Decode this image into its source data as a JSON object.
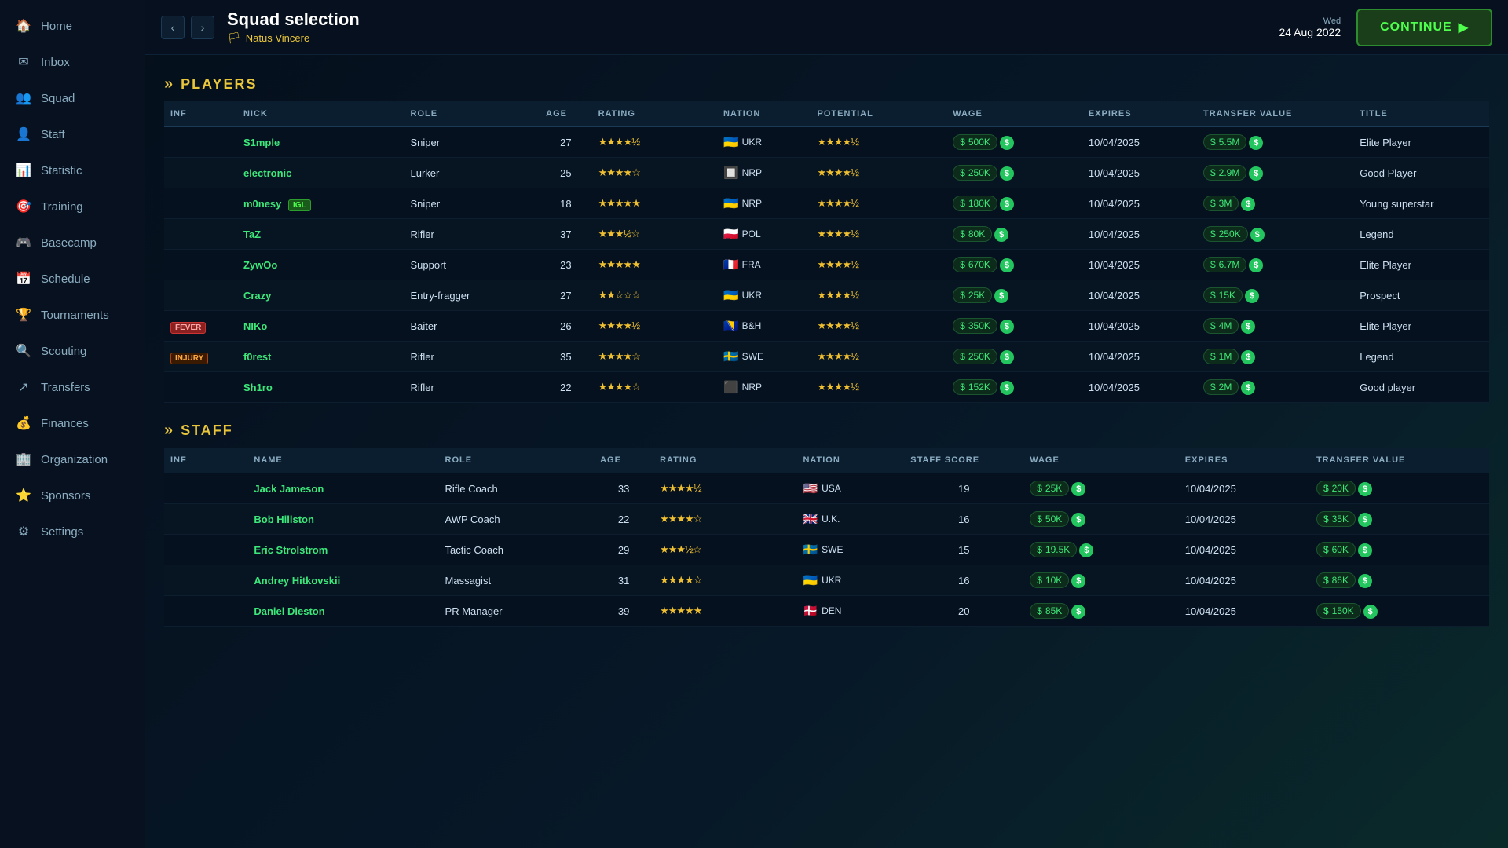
{
  "sidebar": {
    "items": [
      {
        "id": "home",
        "label": "Home",
        "icon": "🏠"
      },
      {
        "id": "inbox",
        "label": "Inbox",
        "icon": "✉"
      },
      {
        "id": "squad",
        "label": "Squad",
        "icon": "👥"
      },
      {
        "id": "staff",
        "label": "Staff",
        "icon": "👤"
      },
      {
        "id": "statistic",
        "label": "Statistic",
        "icon": "📊"
      },
      {
        "id": "training",
        "label": "Training",
        "icon": "🎯"
      },
      {
        "id": "basecamp",
        "label": "Basecamp",
        "icon": "🎮"
      },
      {
        "id": "schedule",
        "label": "Schedule",
        "icon": "📅"
      },
      {
        "id": "tournaments",
        "label": "Tournaments",
        "icon": "🏆"
      },
      {
        "id": "scouting",
        "label": "Scouting",
        "icon": "🔍"
      },
      {
        "id": "transfers",
        "label": "Transfers",
        "icon": "↗"
      },
      {
        "id": "finances",
        "label": "Finances",
        "icon": "💰"
      },
      {
        "id": "organization",
        "label": "Organization",
        "icon": "🏢"
      },
      {
        "id": "sponsors",
        "label": "Sponsors",
        "icon": "⭐"
      },
      {
        "id": "settings",
        "label": "Settings",
        "icon": "⚙"
      }
    ]
  },
  "topbar": {
    "page_title": "Squad selection",
    "team_name": "Natus Vincere",
    "date_label": "Wed",
    "date_full": "24 Aug 2022",
    "continue_label": "CONTINUE"
  },
  "players_section": {
    "title": "PLAYERS",
    "columns": [
      "INF",
      "NICK",
      "ROLE",
      "AGE",
      "RATING",
      "NATION",
      "POTENTIAL",
      "WAGE",
      "EXPIRES",
      "TRANSFER VALUE",
      "TITLE"
    ],
    "rows": [
      {
        "inf": "",
        "nick": "S1mple",
        "role": "Sniper",
        "age": "27",
        "rating": 4.5,
        "flag": "🇺🇦",
        "nation": "UKR",
        "potential": 4.5,
        "wage": "500K",
        "expires": "10/04/2025",
        "transfer": "5.5M",
        "title": "Elite Player",
        "title_class": "title-elite",
        "badge": ""
      },
      {
        "inf": "",
        "nick": "electronic",
        "role": "Lurker",
        "age": "25",
        "rating": 4.0,
        "flag": "🔲",
        "nation": "NRP",
        "potential": 4.5,
        "wage": "250K",
        "expires": "10/04/2025",
        "transfer": "2.9M",
        "title": "Good Player",
        "title_class": "title-good",
        "badge": ""
      },
      {
        "inf": "",
        "nick": "m0nesy",
        "role": "Sniper",
        "age": "18",
        "rating": 5.0,
        "flag": "🇺🇦",
        "nation": "NRP",
        "potential": 4.5,
        "wage": "180K",
        "expires": "10/04/2025",
        "transfer": "3M",
        "title": "Young superstar",
        "title_class": "title-young",
        "badge": "IGL"
      },
      {
        "inf": "",
        "nick": "TaZ",
        "role": "Rifler",
        "age": "37",
        "rating": 3.5,
        "flag": "🇵🇱",
        "nation": "POL",
        "potential": 4.5,
        "wage": "80K",
        "expires": "10/04/2025",
        "transfer": "250K",
        "title": "Legend",
        "title_class": "title-legend",
        "badge": ""
      },
      {
        "inf": "",
        "nick": "ZywOo",
        "role": "Support",
        "age": "23",
        "rating": 5.0,
        "flag": "🇫🇷",
        "nation": "FRA",
        "potential": 4.5,
        "wage": "670K",
        "expires": "10/04/2025",
        "transfer": "6.7M",
        "title": "Elite Player",
        "title_class": "title-elite",
        "badge": ""
      },
      {
        "inf": "",
        "nick": "Crazy",
        "role": "Entry-fragger",
        "age": "27",
        "rating": 2.0,
        "flag": "🇺🇦",
        "nation": "UKR",
        "potential": 4.5,
        "wage": "25K",
        "expires": "10/04/2025",
        "transfer": "15K",
        "title": "Prospect",
        "title_class": "title-prospect",
        "badge": ""
      },
      {
        "inf": "FEVER",
        "nick": "NIKo",
        "role": "Baiter",
        "age": "26",
        "rating": 4.5,
        "flag": "🇧🇦",
        "nation": "B&H",
        "potential": 4.5,
        "wage": "350K",
        "expires": "10/04/2025",
        "transfer": "4M",
        "title": "Elite Player",
        "title_class": "title-elite",
        "badge": ""
      },
      {
        "inf": "INJURY",
        "nick": "f0rest",
        "role": "Rifler",
        "age": "35",
        "rating": 4.0,
        "flag": "🇸🇪",
        "nation": "SWE",
        "potential": 4.5,
        "wage": "250K",
        "expires": "10/04/2025",
        "transfer": "1M",
        "title": "Legend",
        "title_class": "title-legend",
        "badge": ""
      },
      {
        "inf": "",
        "nick": "Sh1ro",
        "role": "Rifler",
        "age": "22",
        "rating": 4.0,
        "flag": "⬛",
        "nation": "NRP",
        "potential": 4.5,
        "wage": "152K",
        "expires": "10/04/2025",
        "transfer": "2M",
        "title": "Good player",
        "title_class": "title-good",
        "badge": ""
      }
    ]
  },
  "staff_section": {
    "title": "STAFF",
    "columns": [
      "INF",
      "NAME",
      "ROLE",
      "AGE",
      "RATING",
      "NATION",
      "STAFF SCORE",
      "WAGE",
      "EXPIRES",
      "TRANSFER VALUE"
    ],
    "rows": [
      {
        "inf": "",
        "name": "Jack Jameson",
        "role": "Rifle Coach",
        "age": "33",
        "rating": 4.5,
        "flag": "🇺🇸",
        "nation": "USA",
        "score": "19",
        "wage": "25K",
        "expires": "10/04/2025",
        "transfer": "20K"
      },
      {
        "inf": "",
        "name": "Bob Hillston",
        "role": "AWP Coach",
        "age": "22",
        "rating": 4.0,
        "flag": "🇬🇧",
        "nation": "U.K.",
        "score": "16",
        "wage": "50K",
        "expires": "10/04/2025",
        "transfer": "35K"
      },
      {
        "inf": "",
        "name": "Eric Strolstrom",
        "role": "Tactic Coach",
        "age": "29",
        "rating": 3.5,
        "flag": "🇸🇪",
        "nation": "SWE",
        "score": "15",
        "wage": "19.5K",
        "expires": "10/04/2025",
        "transfer": "60K"
      },
      {
        "inf": "",
        "name": "Andrey Hitkovskii",
        "role": "Massagist",
        "age": "31",
        "rating": 4.0,
        "flag": "🇺🇦",
        "nation": "UKR",
        "score": "16",
        "wage": "10K",
        "expires": "10/04/2025",
        "transfer": "86K"
      },
      {
        "inf": "",
        "name": "Daniel Dieston",
        "role": "PR Manager",
        "age": "39",
        "rating": 5.0,
        "flag": "🇩🇰",
        "nation": "DEN",
        "score": "20",
        "wage": "85K",
        "expires": "10/04/2025",
        "transfer": "150K"
      }
    ]
  }
}
